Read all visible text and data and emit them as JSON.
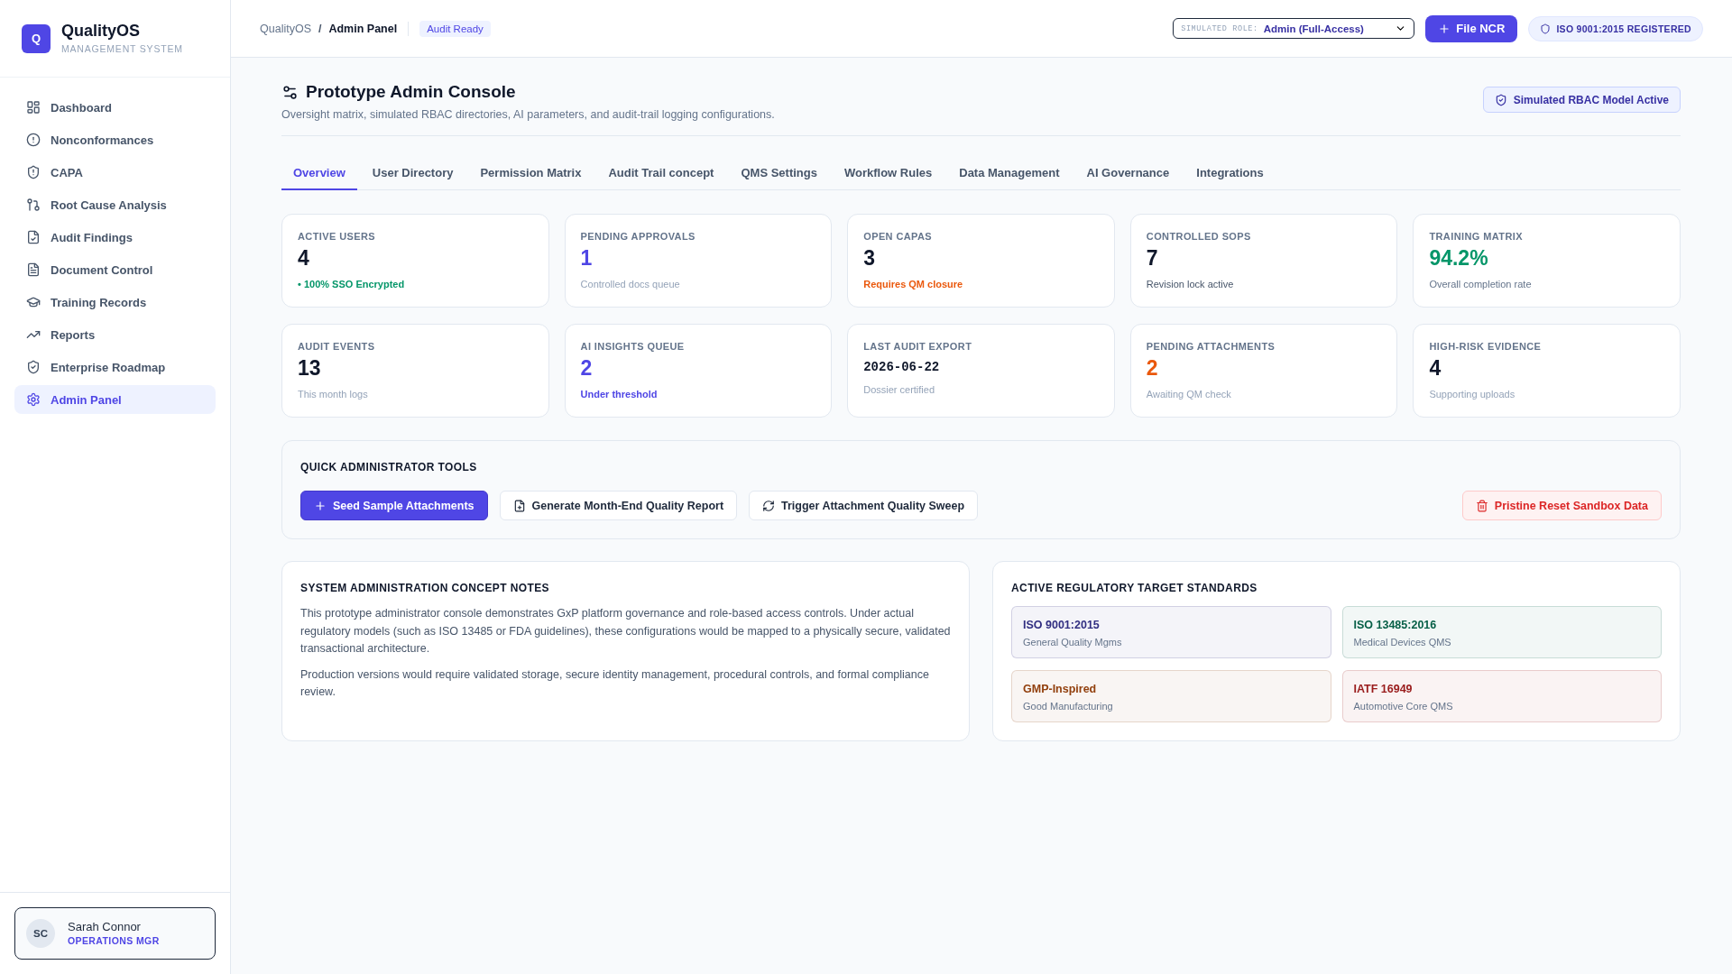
{
  "sidebar": {
    "logo": {
      "mark": "Q",
      "name": "QualityOS",
      "tagline": "MANAGEMENT SYSTEM"
    },
    "items": [
      {
        "label": "Dashboard",
        "selected": false
      },
      {
        "label": "Nonconformances",
        "selected": false
      },
      {
        "label": "CAPA",
        "selected": false
      },
      {
        "label": "Root Cause Analysis",
        "selected": false
      },
      {
        "label": "Audit Findings",
        "selected": false
      },
      {
        "label": "Document Control",
        "selected": false
      },
      {
        "label": "Training Records",
        "selected": false
      },
      {
        "label": "Reports",
        "selected": false
      },
      {
        "label": "Enterprise Roadmap",
        "selected": false
      },
      {
        "label": "Admin Panel",
        "selected": true
      }
    ],
    "user": {
      "initials": "SC",
      "name": "Sarah Connor",
      "role": "OPERATIONS MGR"
    }
  },
  "header": {
    "breadcrumb": {
      "root": "QualityOS",
      "separator": "/",
      "current": "Admin Panel"
    },
    "status_badge": "Audit Ready",
    "role_select": {
      "label": "SIMULATED ROLE:",
      "value": "Admin (Full-Access)"
    },
    "primary_button": "File NCR",
    "certification_badge": "ISO 9001:2015 REGISTERED"
  },
  "page": {
    "title": "Prototype Admin Console",
    "subtitle": "Oversight matrix, simulated RBAC directories, AI parameters, and audit-trail logging configurations.",
    "status_button": "Simulated RBAC Model Active"
  },
  "tabs": [
    {
      "label": "Overview",
      "selected": true
    },
    {
      "label": "User Directory",
      "selected": false
    },
    {
      "label": "Permission Matrix",
      "selected": false
    },
    {
      "label": "Audit Trail concept",
      "selected": false
    },
    {
      "label": "QMS Settings",
      "selected": false
    },
    {
      "label": "Workflow Rules",
      "selected": false
    },
    {
      "label": "Data Management",
      "selected": false
    },
    {
      "label": "AI Governance",
      "selected": false
    },
    {
      "label": "Integrations",
      "selected": false
    }
  ],
  "stats": [
    {
      "kind": "number",
      "label": "ACTIVE USERS",
      "value": {
        "text": "4",
        "color": "#0f172a"
      },
      "note": {
        "text": "• 100% SSO Encrypted",
        "color": "#059669",
        "strong": true
      }
    },
    {
      "kind": "number",
      "label": "PENDING APPROVALS",
      "value": {
        "text": "1",
        "color": "#4f46e5"
      },
      "note": {
        "text": "Controlled docs queue",
        "color": "#94a3b8",
        "strong": false
      }
    },
    {
      "kind": "number",
      "label": "OPEN CAPAS",
      "value": {
        "text": "3",
        "color": "#0f172a"
      },
      "note": {
        "text": "Requires QM closure",
        "color": "#ea580c",
        "strong": true
      }
    },
    {
      "kind": "number",
      "label": "CONTROLLED SOPS",
      "value": {
        "text": "7",
        "color": "#0f172a"
      },
      "note": {
        "text": "Revision lock active",
        "color": "#475569",
        "strong": false
      }
    },
    {
      "kind": "number",
      "label": "TRAINING MATRIX",
      "value": {
        "text": "94.2%",
        "color": "#059669"
      },
      "note": {
        "text": "Overall completion rate",
        "color": "#64748b",
        "strong": false
      }
    },
    {
      "kind": "number",
      "label": "AUDIT EVENTS",
      "value": {
        "text": "13",
        "color": "#0f172a"
      },
      "note": {
        "text": "This month logs",
        "color": "#94a3b8",
        "strong": false
      }
    },
    {
      "kind": "number",
      "label": "AI INSIGHTS QUEUE",
      "value": {
        "text": "2",
        "color": "#4f46e5"
      },
      "note": {
        "text": "Under threshold",
        "color": "#4f46e5",
        "strong": true
      }
    },
    {
      "kind": "date",
      "label": "LAST AUDIT EXPORT",
      "value": {
        "text": "2026-06-22",
        "color": "#0f172a"
      },
      "note": {
        "text": "Dossier certified",
        "color": "#94a3b8",
        "strong": false
      }
    },
    {
      "kind": "number",
      "label": "PENDING ATTACHMENTS",
      "value": {
        "text": "2",
        "color": "#ea580c"
      },
      "note": {
        "text": "Awaiting QM check",
        "color": "#94a3b8",
        "strong": false
      }
    },
    {
      "kind": "number",
      "label": "HIGH-RISK EVIDENCE",
      "value": {
        "text": "4",
        "color": "#0f172a"
      },
      "note": {
        "text": "Supporting uploads",
        "color": "#94a3b8",
        "strong": false
      }
    }
  ],
  "quick_tools": {
    "title": "QUICK ADMINISTRATOR TOOLS",
    "buttons": [
      {
        "kind": "primary",
        "label": "Seed Sample Attachments"
      },
      {
        "kind": "secondary",
        "label": "Generate Month-End Quality Report"
      },
      {
        "kind": "secondary",
        "label": "Trigger Attachment Quality Sweep"
      },
      {
        "kind": "danger",
        "label": "Pristine Reset Sandbox Data"
      }
    ]
  },
  "notes": {
    "title": "SYSTEM ADMINISTRATION CONCEPT NOTES",
    "paragraphs": [
      "This prototype administrator console demonstrates GxP platform governance and role-based access controls. Under actual regulatory models (such as ISO 13485 or FDA guidelines), these configurations would be mapped to a physically secure, validated transactional architecture.",
      "Production versions would require validated storage, secure identity management, procedural controls, and formal compliance review."
    ]
  },
  "standards": {
    "title": "ACTIVE REGULATORY TARGET STANDARDS",
    "items": [
      {
        "name": "ISO 9001:2015",
        "description": "General Quality Mgms",
        "color": "#312e81"
      },
      {
        "name": "ISO 13485:2016",
        "description": "Medical Devices QMS",
        "color": "#065f46"
      },
      {
        "name": "GMP-Inspired",
        "description": "Good Manufacturing",
        "color": "#92400e"
      },
      {
        "name": "IATF 16949",
        "description": "Automotive Core QMS",
        "color": "#991b1b"
      }
    ]
  }
}
